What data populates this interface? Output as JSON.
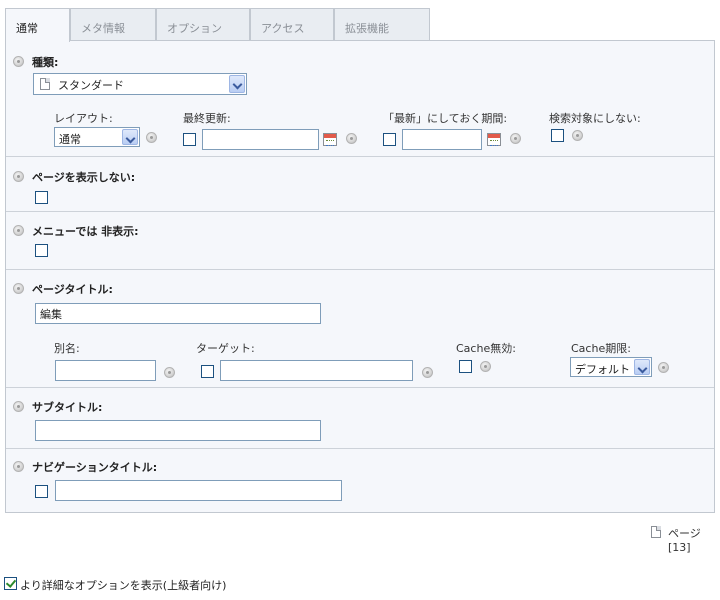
{
  "tabs": [
    {
      "label": "通常",
      "active": true
    },
    {
      "label": "メタ情報",
      "active": false
    },
    {
      "label": "オプション",
      "active": false
    },
    {
      "label": "アクセス",
      "active": false
    },
    {
      "label": "拡張機能",
      "active": false
    }
  ],
  "type_section": {
    "label": "種類:",
    "doktype_value": "スタンダード",
    "layout_label": "レイアウト:",
    "layout_value": "通常",
    "lastupdated_label": "最終更新:",
    "lastupdated_value": "",
    "newuntil_label": "「最新」にしておく期間:",
    "newuntil_value": "",
    "nosearch_label": "検索対象にしない:"
  },
  "hide_section": {
    "label": "ページを表示しない:"
  },
  "nav_hide_section": {
    "label": "メニューでは 非表示:"
  },
  "title_section": {
    "label": "ページタイトル:",
    "title_value": "編集",
    "alias_label": "別名:",
    "alias_value": "",
    "target_label": "ターゲット:",
    "target_value": "",
    "no_cache_label": "Cache無効:",
    "cache_timeout_label": "Cache期限:",
    "cache_timeout_value": "デフォルト"
  },
  "subtitle_section": {
    "label": "サブタイトル:",
    "value": ""
  },
  "navtitle_section": {
    "label": "ナビゲーションタイトル:",
    "value": ""
  },
  "footer": {
    "page_ref": "ページ [13]",
    "advanced_options_label": "より詳細なオプションを表示(上級者向け)",
    "advanced_checked": true
  }
}
